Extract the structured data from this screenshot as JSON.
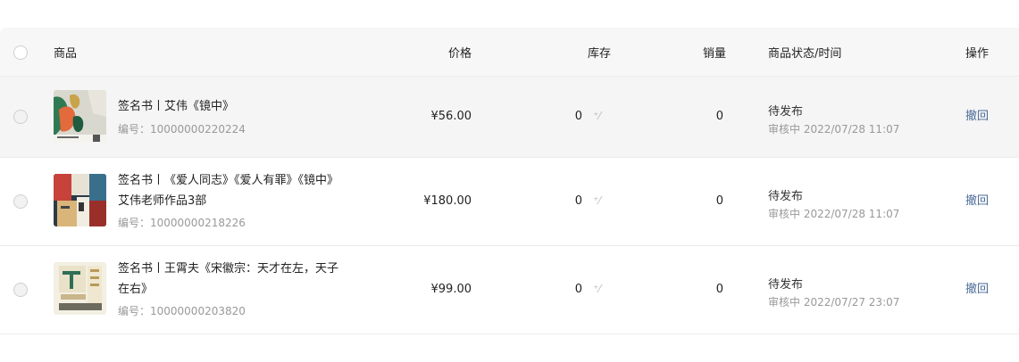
{
  "header": {
    "product": "商品",
    "price": "价格",
    "stock": "库存",
    "sales": "销量",
    "status_time": "商品状态/时间",
    "ops": "操作"
  },
  "rows": [
    {
      "title": "签名书丨艾伟《镜中》",
      "code": "编号：10000000220224",
      "price": "¥56.00",
      "stock": "0",
      "edit_icon": "edit-stock-icon",
      "sales": "0",
      "status": "待发布",
      "time": "审核中 2022/07/28 11:07",
      "action": "撤回"
    },
    {
      "title": "签名书丨《爱人同志》《爱人有罪》《镜中》艾伟老师作品3部",
      "code": "编号：10000000218226",
      "price": "¥180.00",
      "stock": "0",
      "edit_icon": "edit-stock-icon",
      "sales": "0",
      "status": "待发布",
      "time": "审核中 2022/07/28 11:07",
      "action": "撤回"
    },
    {
      "title": "签名书丨王霄夫《宋徽宗：天才在左，天子在右》",
      "code": "编号：10000000203820",
      "price": "¥99.00",
      "stock": "0",
      "edit_icon": "edit-stock-icon",
      "sales": "0",
      "status": "待发布",
      "time": "审核中 2022/07/27 23:07",
      "action": "撤回"
    }
  ],
  "colors": {
    "header_bg": "#f7f7f7",
    "row_highlight_bg": "#f5f5f5",
    "action_link": "#4a6a96",
    "muted_text": "#999999"
  }
}
